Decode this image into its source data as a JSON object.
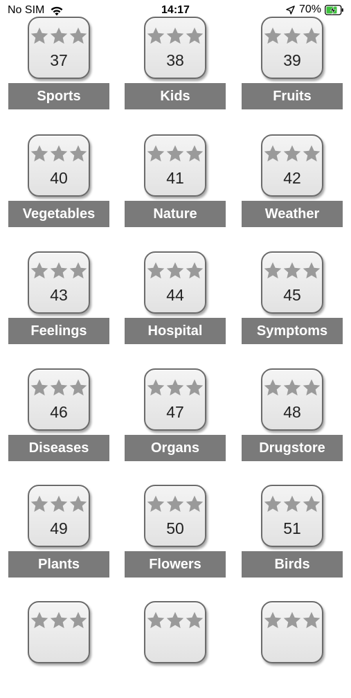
{
  "status_bar": {
    "carrier": "No SIM",
    "time": "14:17",
    "battery_percent": "70%"
  },
  "levels": [
    {
      "number": "37",
      "category": "Sports",
      "stars": 3
    },
    {
      "number": "38",
      "category": "Kids",
      "stars": 3
    },
    {
      "number": "39",
      "category": "Fruits",
      "stars": 3
    },
    {
      "number": "40",
      "category": "Vegetables",
      "stars": 3
    },
    {
      "number": "41",
      "category": "Nature",
      "stars": 3
    },
    {
      "number": "42",
      "category": "Weather",
      "stars": 3
    },
    {
      "number": "43",
      "category": "Feelings",
      "stars": 3
    },
    {
      "number": "44",
      "category": "Hospital",
      "stars": 3
    },
    {
      "number": "45",
      "category": "Symptoms",
      "stars": 3
    },
    {
      "number": "46",
      "category": "Diseases",
      "stars": 3
    },
    {
      "number": "47",
      "category": "Organs",
      "stars": 3
    },
    {
      "number": "48",
      "category": "Drugstore",
      "stars": 3
    },
    {
      "number": "49",
      "category": "Plants",
      "stars": 3
    },
    {
      "number": "50",
      "category": "Flowers",
      "stars": 3
    },
    {
      "number": "51",
      "category": "Birds",
      "stars": 3
    }
  ],
  "partial_row_star_count": 3,
  "colors": {
    "star": "#9a9a9a",
    "label_background": "#7a7a7a",
    "battery_charging": "#3cc13c"
  }
}
